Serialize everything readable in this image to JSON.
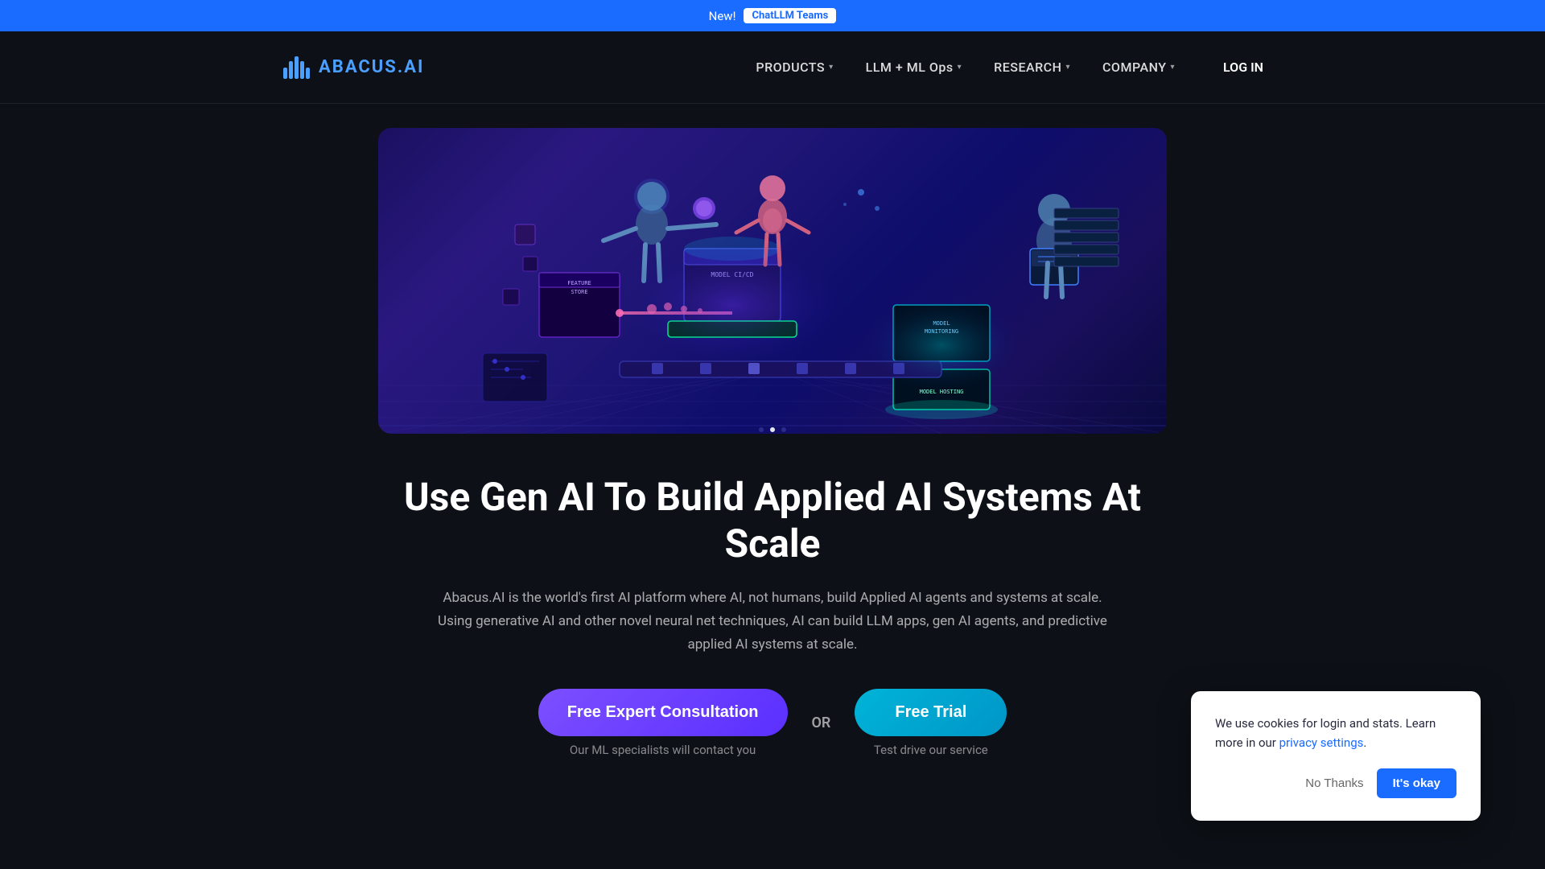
{
  "banner": {
    "new_label": "New!",
    "link_text": "ChatLLM Teams"
  },
  "navbar": {
    "logo_text": "ABACUS",
    "logo_suffix": ".AI",
    "nav_items": [
      {
        "label": "PRODUCTS",
        "has_dropdown": true
      },
      {
        "label": "LLM + ML Ops",
        "has_dropdown": true
      },
      {
        "label": "RESEARCH",
        "has_dropdown": true
      },
      {
        "label": "COMPANY",
        "has_dropdown": true
      }
    ],
    "login_label": "LOG IN"
  },
  "hero": {
    "alt": "AI Systems Illustration"
  },
  "content": {
    "heading": "Use Gen AI To Build Applied AI Systems At Scale",
    "description": "Abacus.AI is the world's first AI platform where AI, not humans, build Applied AI agents and systems at scale. Using generative AI and other novel neural net techniques, AI can build LLM apps, gen AI agents, and predictive applied AI systems at scale."
  },
  "cta": {
    "consultation_label": "Free Expert Consultation",
    "consultation_sub": "Our ML specialists will contact you",
    "or_text": "OR",
    "trial_label": "Free Trial",
    "trial_sub": "Test drive our service"
  },
  "cookie": {
    "message": "We use cookies for login and stats. Learn more in our ",
    "link_text": "privacy settings",
    "link_suffix": ".",
    "no_thanks_label": "No Thanks",
    "okay_label": "It's okay"
  }
}
